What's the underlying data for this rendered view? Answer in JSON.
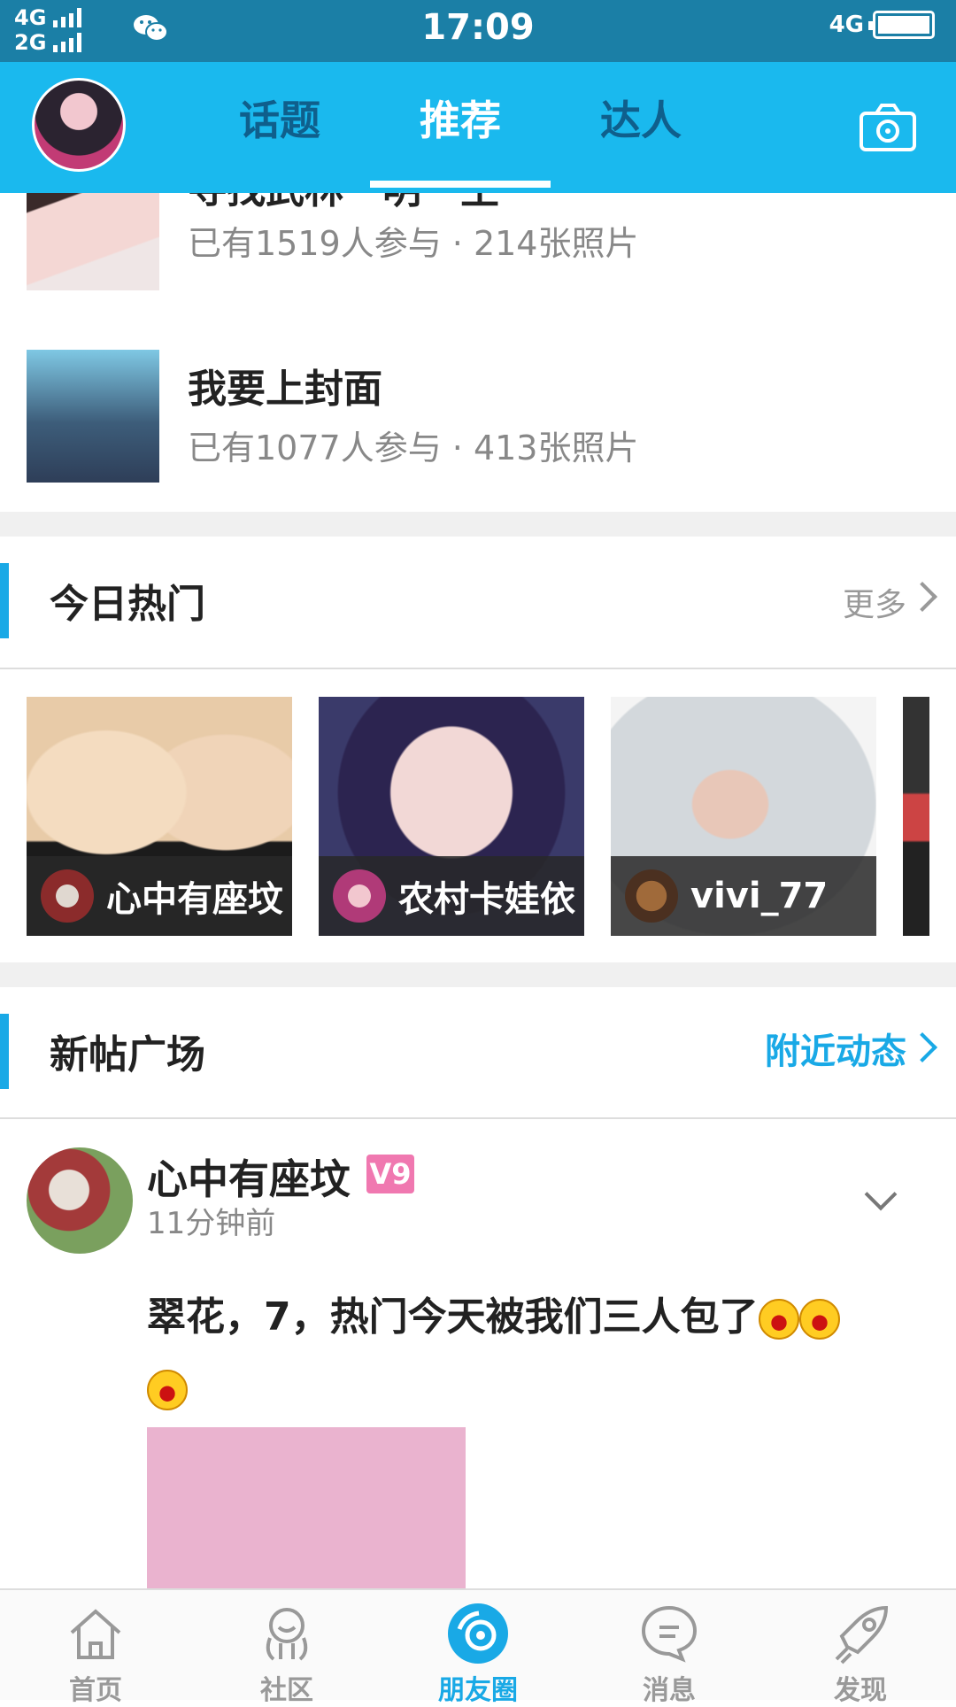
{
  "status_bar": {
    "net1": "4G",
    "net2": "2G",
    "time": "17:09",
    "net_right": "4G"
  },
  "header": {
    "tabs": [
      {
        "label": "话题"
      },
      {
        "label": "推荐"
      },
      {
        "label": "达人"
      }
    ],
    "active_tab": "推荐",
    "accent_color": "#1ab9ee"
  },
  "topics": [
    {
      "title": "寻找武林一明一主",
      "meta": "已有1519人参与 · 214张照片"
    },
    {
      "title": "我要上封面",
      "meta": "已有1077人参与 · 413张照片"
    }
  ],
  "hot_section": {
    "title": "今日热门",
    "more": "更多",
    "items": [
      {
        "name": "心中有座坟"
      },
      {
        "name": "农村卡娃依"
      },
      {
        "name": "vivi_77"
      }
    ]
  },
  "new_section": {
    "title": "新帖广场",
    "link": "附近动态"
  },
  "post": {
    "user": "心中有座坟",
    "badge": "V9",
    "time": "11分钟前",
    "text": "翠花，7，热门今天被我们三人包了"
  },
  "tabbar": {
    "items": [
      {
        "label": "首页",
        "icon": "home-icon"
      },
      {
        "label": "社区",
        "icon": "community-icon"
      },
      {
        "label": "朋友圈",
        "icon": "moments-icon"
      },
      {
        "label": "消息",
        "icon": "message-icon"
      },
      {
        "label": "发现",
        "icon": "discover-icon"
      }
    ],
    "active": "朋友圈"
  }
}
